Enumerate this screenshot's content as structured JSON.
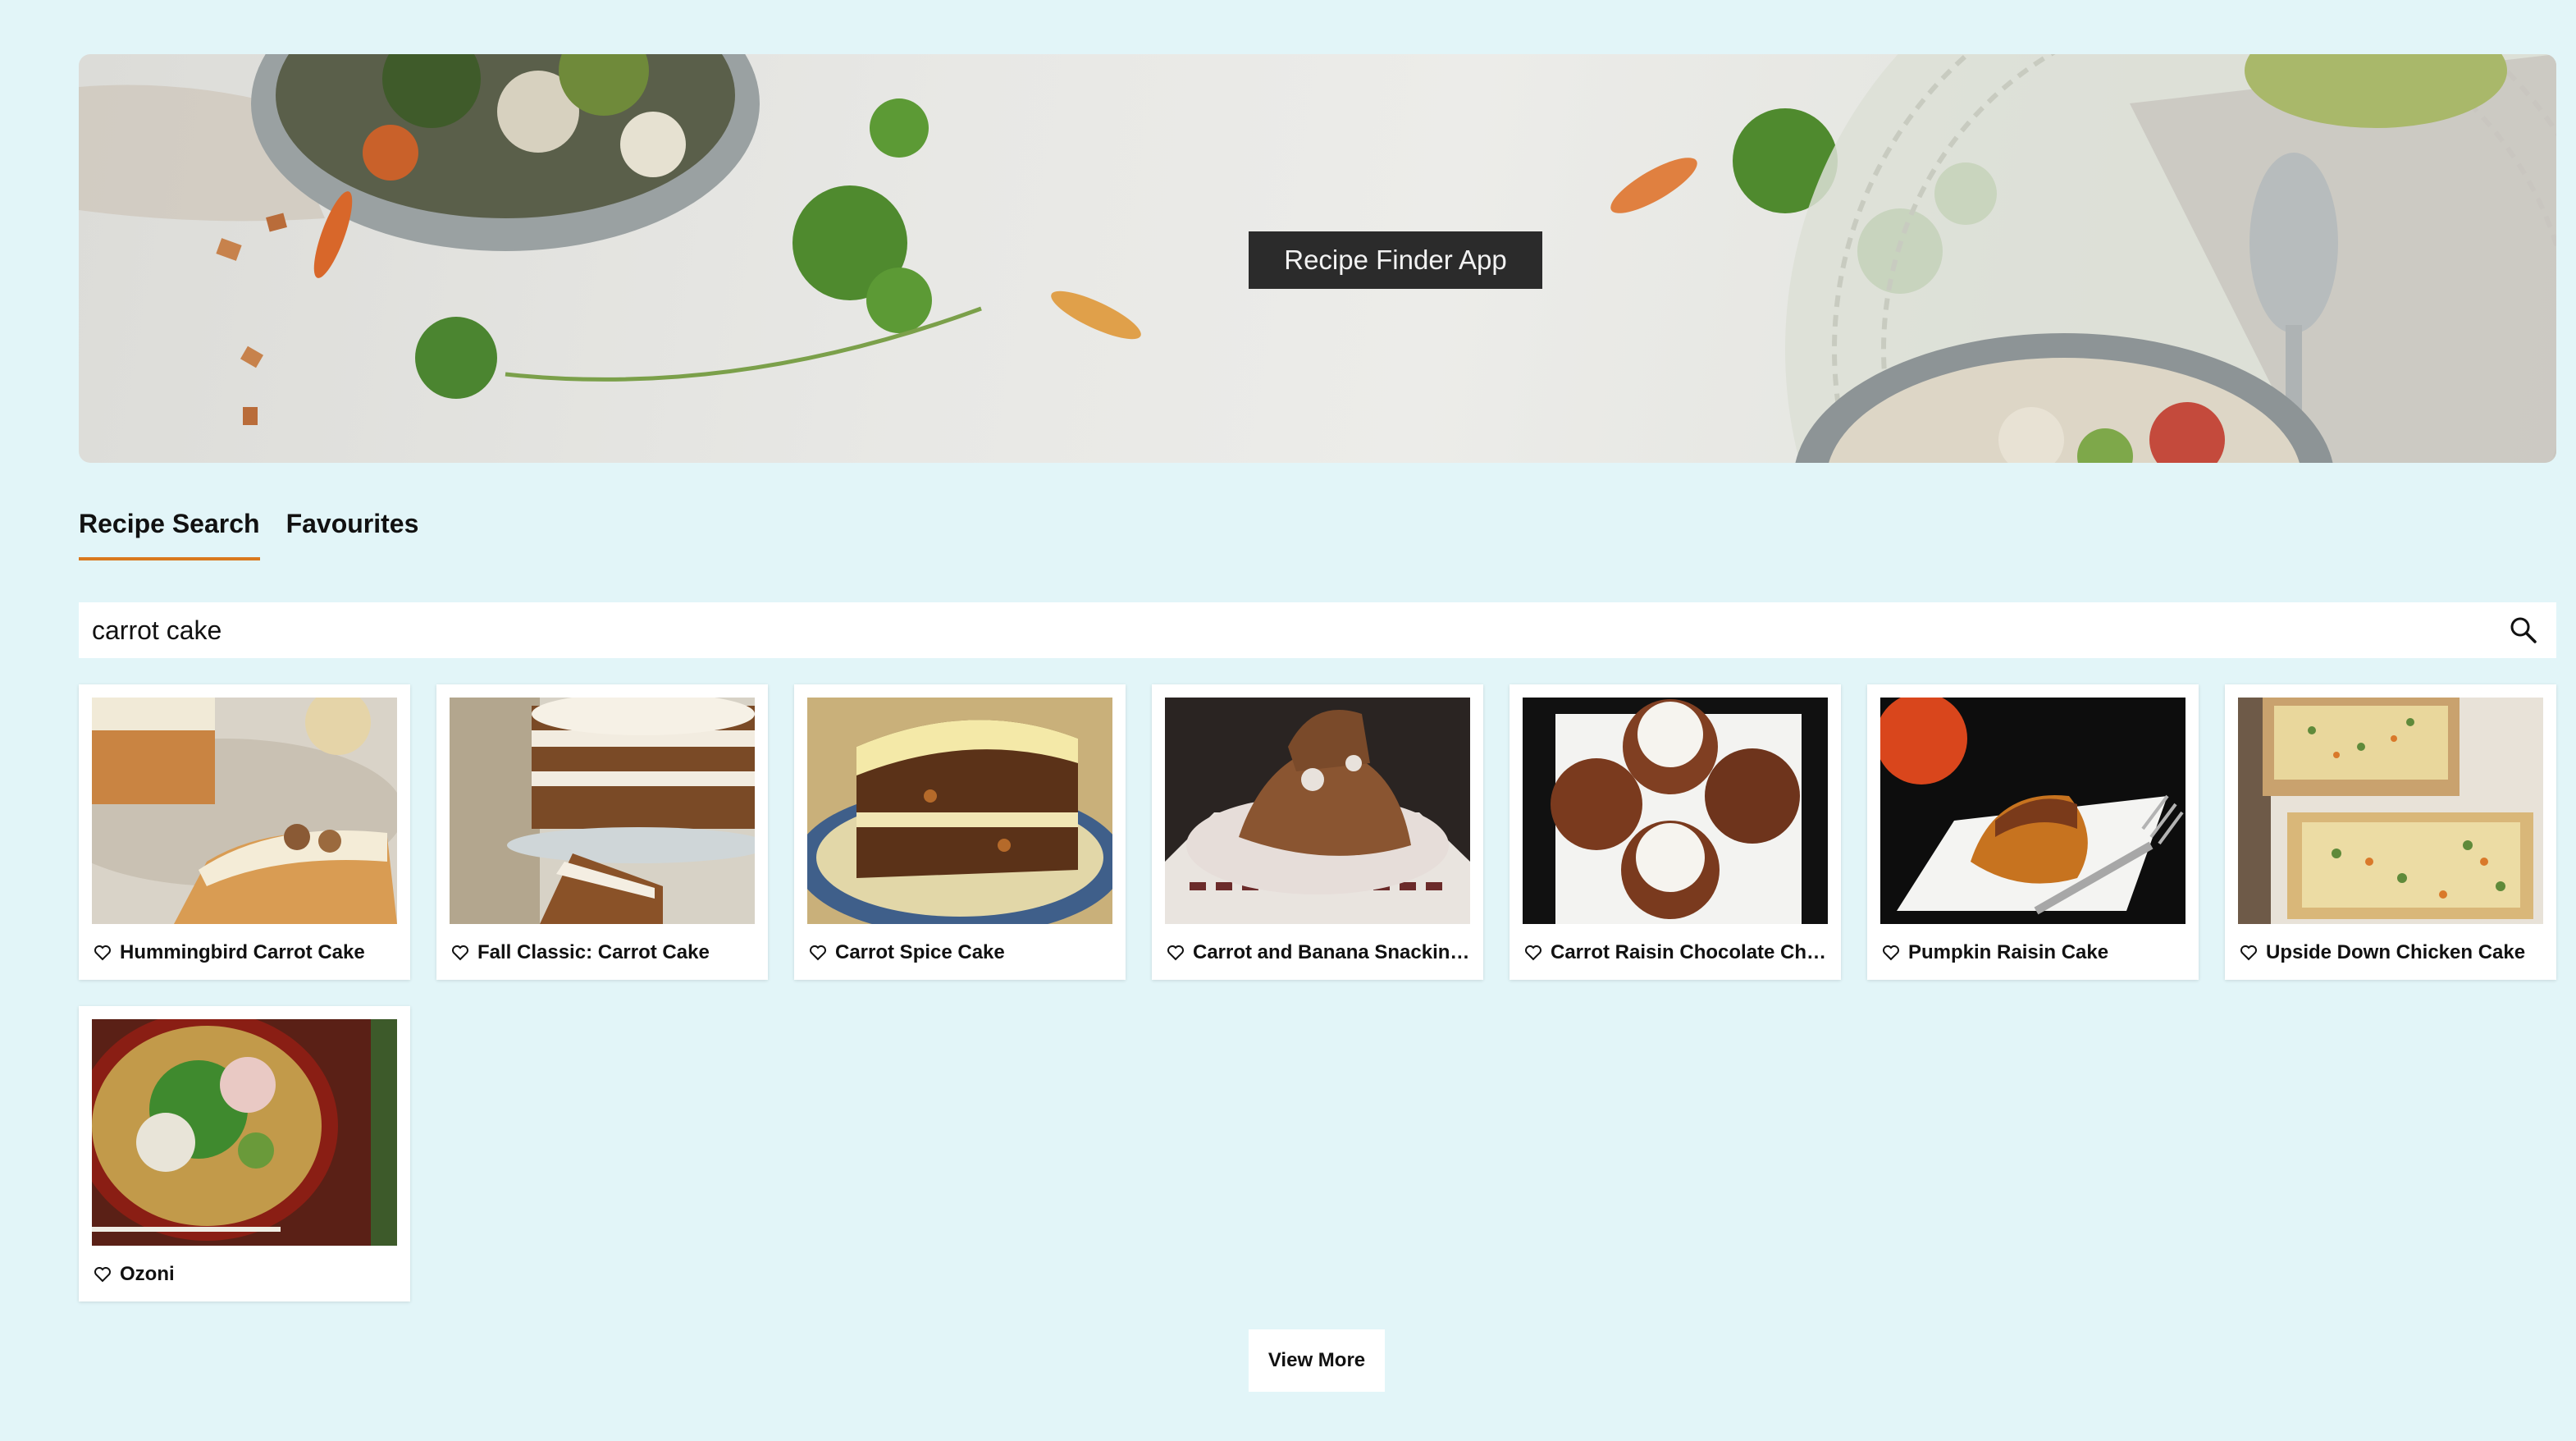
{
  "banner": {
    "title": "Recipe Finder App"
  },
  "tabs": [
    {
      "label": "Recipe Search",
      "active": true
    },
    {
      "label": "Favourites",
      "active": false
    }
  ],
  "search": {
    "value": "carrot cake",
    "icon": "search-icon"
  },
  "recipes": [
    {
      "title": "Hummingbird Carrot Cake",
      "favourite": false
    },
    {
      "title": "Fall Classic: Carrot Cake",
      "favourite": false
    },
    {
      "title": "Carrot Spice Cake",
      "favourite": false
    },
    {
      "title": "Carrot and Banana Snacking Cake",
      "favourite": false
    },
    {
      "title": "Carrot Raisin Chocolate Chip Cookies",
      "favourite": false
    },
    {
      "title": "Pumpkin Raisin Cake",
      "favourite": false
    },
    {
      "title": "Upside Down Chicken Cake",
      "favourite": false
    },
    {
      "title": "Ozoni",
      "favourite": false
    }
  ],
  "view_more_label": "View More",
  "colors": {
    "background": "#e2f5f8",
    "active_tab_underline": "#d9781e",
    "banner_label_bg": "#2b2b2b"
  }
}
